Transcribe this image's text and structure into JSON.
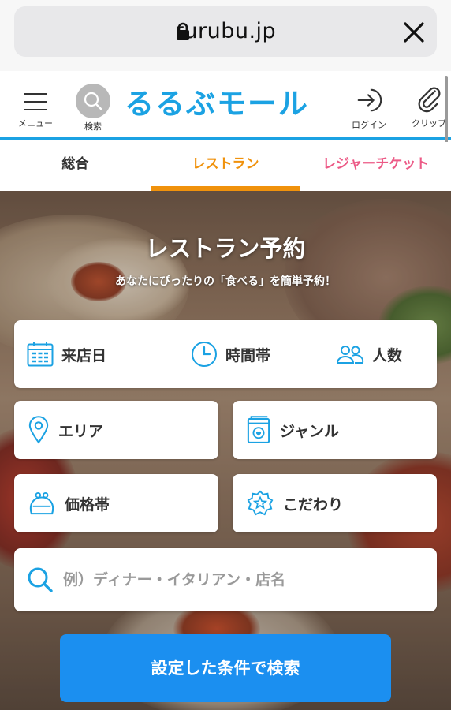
{
  "browser": {
    "url": "rurubu.jp"
  },
  "header": {
    "menu_label": "メニュー",
    "search_label": "検索",
    "logo_text": "るるぶモール",
    "login_label": "ログイン",
    "clip_label": "クリップ"
  },
  "tabs": [
    {
      "label": "総合",
      "active": false
    },
    {
      "label": "レストラン",
      "active": true
    },
    {
      "label": "レジャーチケット",
      "active": false
    }
  ],
  "hero": {
    "title": "レストラン予約",
    "subtitle": "あなたにぴったりの「食べる」を簡単予約！"
  },
  "criteria": {
    "date_label": "来店日",
    "time_label": "時間帯",
    "people_label": "人数",
    "area_label": "エリア",
    "genre_label": "ジャンル",
    "price_label": "価格帯",
    "feature_label": "こだわり"
  },
  "keyword": {
    "placeholder": "例）ディナー・イタリアン・店名",
    "value": ""
  },
  "submit_label": "設定した条件で検索",
  "colors": {
    "brand_blue": "#1ba2e3",
    "restaurant_orange": "#f0920c",
    "leisure_pink": "#ec5a86",
    "button_blue": "#1b8ff0"
  }
}
